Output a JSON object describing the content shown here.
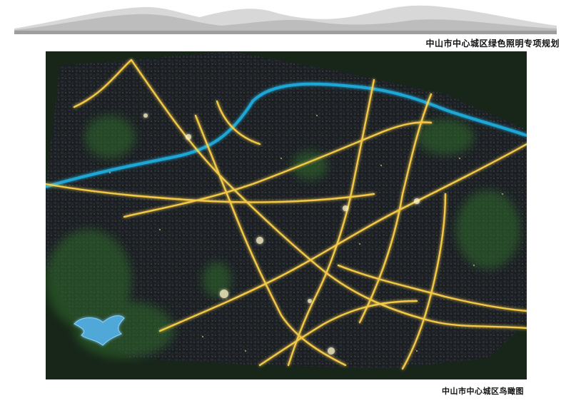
{
  "document": {
    "title": "中山市中心城区绿色照明专项规划"
  },
  "figure": {
    "caption": "中山市中心城区鸟瞰图",
    "colors": {
      "background": "#1c2a1d",
      "city_fabric": "#2b2f36",
      "major_roads": "#ffd24a",
      "river": "#1fa7d6",
      "vegetation": "#2f6b2a",
      "lake": "#8fd3ff"
    }
  }
}
